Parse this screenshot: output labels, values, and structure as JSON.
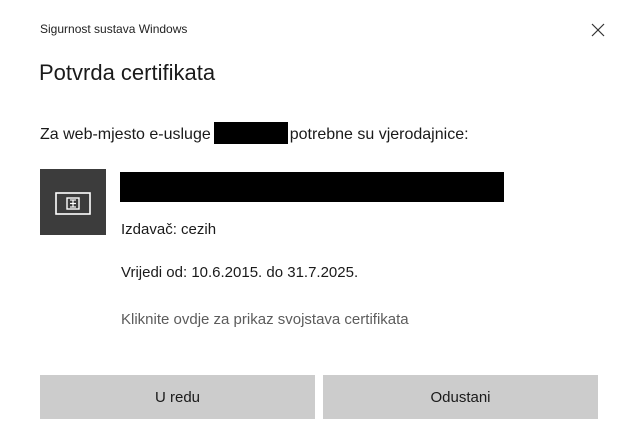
{
  "window": {
    "title": "Sigurnost sustava Windows",
    "close_icon": "close-icon"
  },
  "dialog": {
    "heading": "Potvrda certifikata",
    "message_before": "Za web-mjesto e-usluge",
    "message_after": "potrebne su vjerodajnice:"
  },
  "certificate": {
    "icon": "certificate-card-icon",
    "issuer": "Izdavač: cezih",
    "validity": "Vrijedi od: 10.6.2015. do 31.7.2025.",
    "details_link": "Kliknite ovdje za prikaz svojstava certifikata"
  },
  "buttons": {
    "ok_label": "U redu",
    "cancel_label": "Odustani"
  },
  "colors": {
    "button_bg": "#cccccc",
    "icon_tile_bg": "#3c3c3c",
    "link_text": "#5c5c5c"
  }
}
